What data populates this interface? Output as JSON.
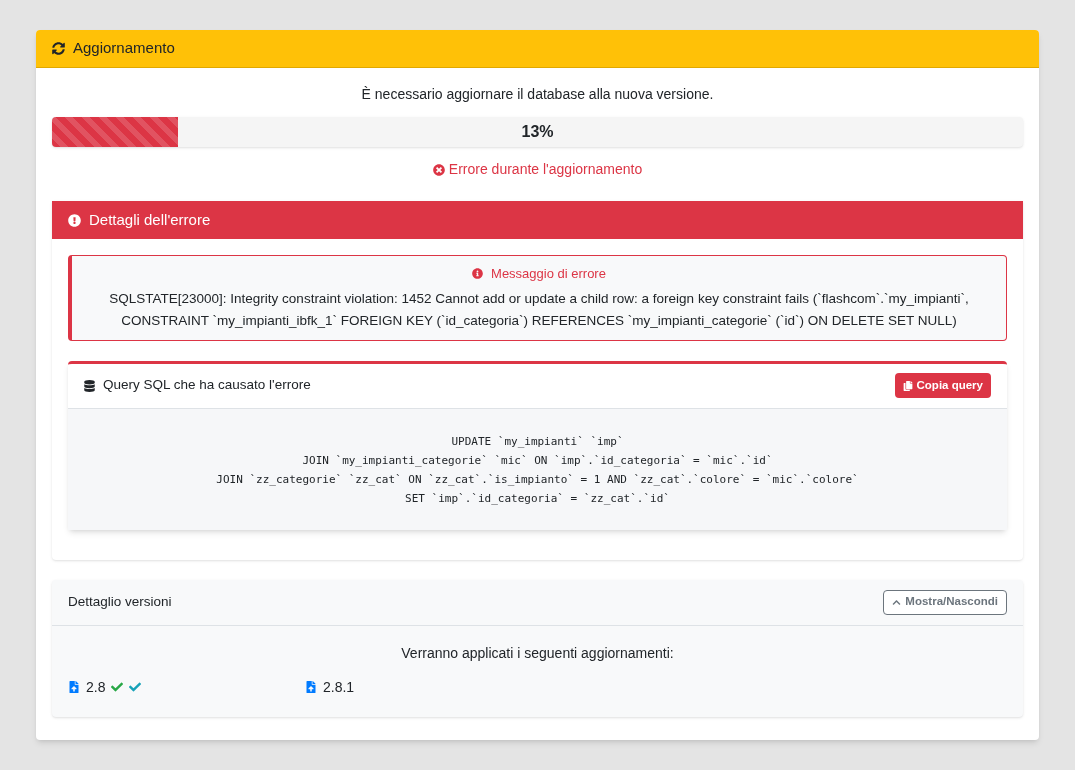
{
  "card": {
    "title": "Aggiornamento"
  },
  "message": "È necessario aggiornare il database alla nuova versione.",
  "progress": {
    "level": 0.13,
    "label": "13%"
  },
  "status": "Errore durante l'aggiornamento",
  "error_panel": {
    "title": "Dettagli dell'errore",
    "alert": {
      "title": "Messaggio di errore",
      "text": "SQLSTATE[23000]: Integrity constraint violation: 1452 Cannot add or update a child row: a foreign key constraint fails (`flashcom`.`my_impianti`, CONSTRAINT `my_impianti_ibfk_1` FOREIGN KEY (`id_categoria`) REFERENCES `my_impianti_categorie` (`id`) ON DELETE SET NULL)"
    },
    "query": {
      "title": "Query SQL che ha causato l'errore",
      "button": "Copia query",
      "lines": [
        "UPDATE `my_impianti` `imp`",
        "JOIN `my_impianti_categorie` `mic` ON `imp`.`id_categoria` = `mic`.`id`",
        "JOIN `zz_categorie` `zz_cat` ON `zz_cat`.`is_impianto` = 1 AND `zz_cat`.`colore` = `mic`.`colore`",
        "SET `imp`.`id_categoria` = `zz_cat`.`id`"
      ]
    }
  },
  "versions": {
    "title": "Dettaglio versioni",
    "toggle": "Mostra/Nascondi",
    "intro": "Verranno applicati i seguenti aggiornamenti:",
    "items": [
      {
        "version": "2.8",
        "checks": [
          {
            "color": "#28a745"
          },
          {
            "color": "#17a2b8"
          }
        ]
      },
      {
        "version": "2.8.1"
      }
    ]
  }
}
